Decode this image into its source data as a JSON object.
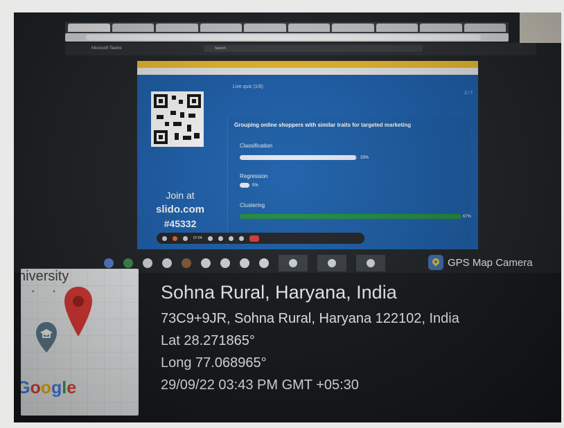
{
  "screen": {
    "sticky_note": "",
    "browser_tabs": [
      "",
      "",
      "",
      "",
      "",
      "",
      "",
      "",
      "",
      ""
    ],
    "teams": {
      "app_title": "Microsoft Teams",
      "search_placeholder": "Search"
    },
    "presenter_label": ""
  },
  "slido": {
    "join_line1": "Join at",
    "join_line2": "slido.com",
    "join_code": "#45332",
    "header": "Live quiz (1/8)",
    "progress": "2 / 7",
    "question": "Grouping online shoppers with similar traits for targeted marketing",
    "options": [
      {
        "label": "Classification",
        "percent": 33,
        "percent_label": "33%",
        "color": "#e6ebf2"
      },
      {
        "label": "Regression",
        "percent": 0,
        "percent_label": "0%",
        "color": "#e6ebf2"
      },
      {
        "label": "Clustering",
        "percent": 67,
        "percent_label": "67%",
        "color": "#1e8f3d"
      }
    ],
    "toolbar_time": "07:04"
  },
  "gps": {
    "app_label": "GPS Map Camera",
    "map_place_fragment": "niversity",
    "google_letters": [
      "G",
      "o",
      "o",
      "g",
      "l",
      "e"
    ],
    "location_title": "Sohna Rural, Haryana, India",
    "address": "73C9+9JR, Sohna Rural, Haryana 122102, India",
    "lat": "Lat 28.271865°",
    "long": "Long 77.068965°",
    "datetime": "29/09/22 03:43 PM GMT +05:30"
  },
  "colors": {
    "slide_bg": "#1a5fae",
    "accent_green": "#1e8f3d",
    "pin_red": "#e53935"
  }
}
